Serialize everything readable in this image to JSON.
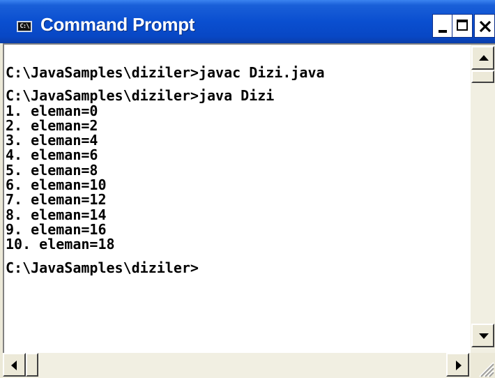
{
  "window": {
    "title": "Command Prompt",
    "icon": "cmd-icon",
    "icon_label": "C:\\"
  },
  "title_buttons": {
    "minimize_icon": "minimize-icon",
    "maximize_icon": "maximize-icon",
    "close_icon": "close-icon"
  },
  "console": {
    "lines": [
      "C:\\JavaSamples\\diziler>javac Dizi.java",
      "",
      "C:\\JavaSamples\\diziler>java Dizi",
      "1. eleman=0",
      "2. eleman=2",
      "3. eleman=4",
      "4. eleman=6",
      "5. eleman=8",
      "6. eleman=10",
      "7. eleman=12",
      "8. eleman=14",
      "9. eleman=16",
      "10. eleman=18",
      "",
      "C:\\JavaSamples\\diziler>"
    ]
  },
  "colors": {
    "titlebar": "#0a4fd0",
    "console_background": "#ffffff",
    "console_text": "#000000"
  }
}
